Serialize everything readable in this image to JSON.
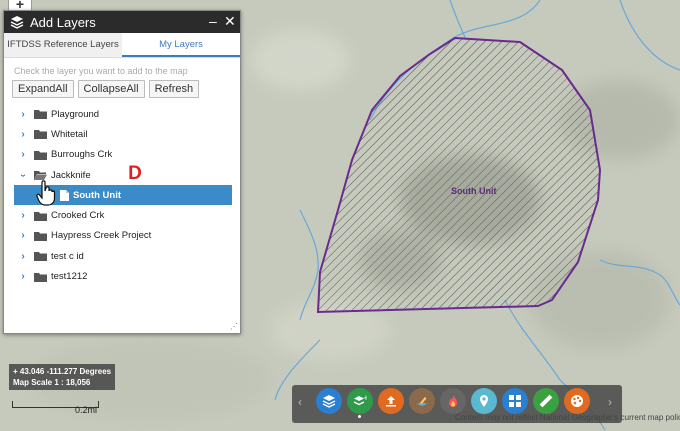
{
  "map": {
    "zoom_in_label": "+",
    "polygon_label": "South Unit",
    "coordinates": "43.046 -111.277 Degrees",
    "map_scale": "Map Scale 1 : 18,056",
    "scalebar_label": "0.2mi",
    "attribution": "Content may not reflect National Geographic's current map policy."
  },
  "panel": {
    "title": "Add Layers",
    "minimize_label": "–",
    "close_label": "✕",
    "tabs": [
      {
        "label": "IFTDSS Reference Layers"
      },
      {
        "label": "My Layers"
      }
    ],
    "hint": "Check the layer you want to add to the map",
    "buttons": {
      "expand": "ExpandAll",
      "collapse": "CollapseAll",
      "refresh": "Refresh"
    },
    "tree": [
      {
        "label": "Playground"
      },
      {
        "label": "Whitetail"
      },
      {
        "label": "Burroughs Crk"
      },
      {
        "label": "Jackknife"
      },
      {
        "label": "South Unit"
      },
      {
        "label": "Crooked Crk"
      },
      {
        "label": "Haypress Creek Project"
      },
      {
        "label": "test c id"
      },
      {
        "label": "test1212"
      }
    ],
    "step_badge": "D"
  },
  "colors": {
    "accent": "#3b7bbf",
    "selected_row": "#3c8bc9",
    "polygon_stroke": "#6a2a8f",
    "badge": "#e02020"
  },
  "toolbar": {
    "buttons": [
      {
        "icon": "layers-icon",
        "color": "#2a7fd0"
      },
      {
        "icon": "add-layers-icon",
        "color": "#2e9a4a"
      },
      {
        "icon": "upload-icon",
        "color": "#e06a20"
      },
      {
        "icon": "edit-layer-icon",
        "color": "#8a6a4a"
      },
      {
        "icon": "fire-icon",
        "color": "#666666"
      },
      {
        "icon": "marker-icon",
        "color": "#5ab8d0"
      },
      {
        "icon": "grid-icon",
        "color": "#2a7fd0"
      },
      {
        "icon": "measure-icon",
        "color": "#3aa040"
      },
      {
        "icon": "palette-icon",
        "color": "#e06a20"
      }
    ]
  }
}
